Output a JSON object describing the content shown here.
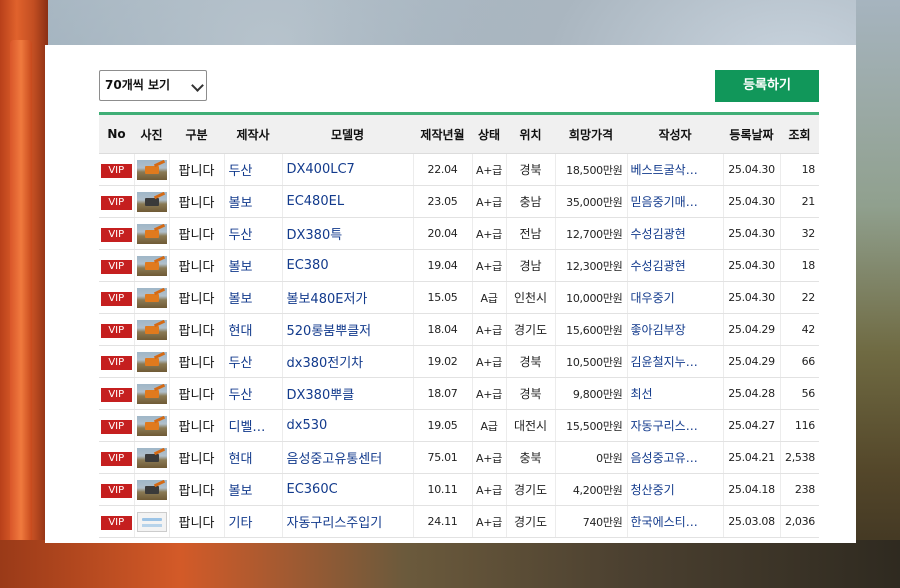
{
  "toolbar": {
    "page_size_select": "70개씩 보기",
    "register_button": "등록하기"
  },
  "table": {
    "headers": [
      "No",
      "사진",
      "구분",
      "제작사",
      "모델명",
      "제작년월",
      "상태",
      "위치",
      "희망가격",
      "작성자",
      "등록날짜",
      "조회"
    ],
    "rows": [
      {
        "no": "VIP",
        "category": "팝니다",
        "maker": "두산",
        "model": "DX400LC7",
        "made": "22.04",
        "condition": "A+급",
        "location": "경북",
        "price": "18,500만원",
        "writer": "베스트굴삭…",
        "date": "25.04.30",
        "views": "18"
      },
      {
        "no": "VIP",
        "category": "팝니다",
        "maker": "볼보",
        "model": "EC480EL",
        "made": "23.05",
        "condition": "A+급",
        "location": "충남",
        "price": "35,000만원",
        "writer": "믿음중기매…",
        "date": "25.04.30",
        "views": "21"
      },
      {
        "no": "VIP",
        "category": "팝니다",
        "maker": "두산",
        "model": "DX380특",
        "made": "20.04",
        "condition": "A+급",
        "location": "전남",
        "price": "12,700만원",
        "writer": "수성김광현",
        "date": "25.04.30",
        "views": "32"
      },
      {
        "no": "VIP",
        "category": "팝니다",
        "maker": "볼보",
        "model": "EC380",
        "made": "19.04",
        "condition": "A+급",
        "location": "경남",
        "price": "12,300만원",
        "writer": "수성김광현",
        "date": "25.04.30",
        "views": "18"
      },
      {
        "no": "VIP",
        "category": "팝니다",
        "maker": "볼보",
        "model": "볼보480E저가",
        "made": "15.05",
        "condition": "A급",
        "location": "인천시",
        "price": "10,000만원",
        "writer": "대우중기",
        "date": "25.04.30",
        "views": "22"
      },
      {
        "no": "VIP",
        "category": "팝니다",
        "maker": "현대",
        "model": "520롱붐뿌클저",
        "made": "18.04",
        "condition": "A+급",
        "location": "경기도",
        "price": "15,600만원",
        "writer": "좋아김부장",
        "date": "25.04.29",
        "views": "42"
      },
      {
        "no": "VIP",
        "category": "팝니다",
        "maker": "두산",
        "model": "dx380전기차",
        "made": "19.02",
        "condition": "A+급",
        "location": "경북",
        "price": "10,500만원",
        "writer": "김윤철지누…",
        "date": "25.04.29",
        "views": "66"
      },
      {
        "no": "VIP",
        "category": "팝니다",
        "maker": "두산",
        "model": "DX380뿌클",
        "made": "18.07",
        "condition": "A+급",
        "location": "경북",
        "price": "9,800만원",
        "writer": "최선",
        "date": "25.04.28",
        "views": "56"
      },
      {
        "no": "VIP",
        "category": "팝니다",
        "maker": "디벨…",
        "model": "dx530",
        "made": "19.05",
        "condition": "A급",
        "location": "대전시",
        "price": "15,500만원",
        "writer": "자동구리스…",
        "date": "25.04.27",
        "views": "116"
      },
      {
        "no": "VIP",
        "category": "팝니다",
        "maker": "현대",
        "model": "음성중고유통센터",
        "made": "75.01",
        "condition": "A+급",
        "location": "충북",
        "price": "0만원",
        "writer": "음성중고유…",
        "date": "25.04.21",
        "views": "2,538"
      },
      {
        "no": "VIP",
        "category": "팝니다",
        "maker": "볼보",
        "model": "EC360C",
        "made": "10.11",
        "condition": "A+급",
        "location": "경기도",
        "price": "4,200만원",
        "writer": "청산중기",
        "date": "25.04.18",
        "views": "238"
      },
      {
        "no": "VIP",
        "category": "팝니다",
        "maker": "기타",
        "model": "자동구리스주입기",
        "made": "24.11",
        "condition": "A+급",
        "location": "경기도",
        "price": "740만원",
        "writer": "한국에스티…",
        "date": "25.03.08",
        "views": "2,036"
      }
    ]
  }
}
